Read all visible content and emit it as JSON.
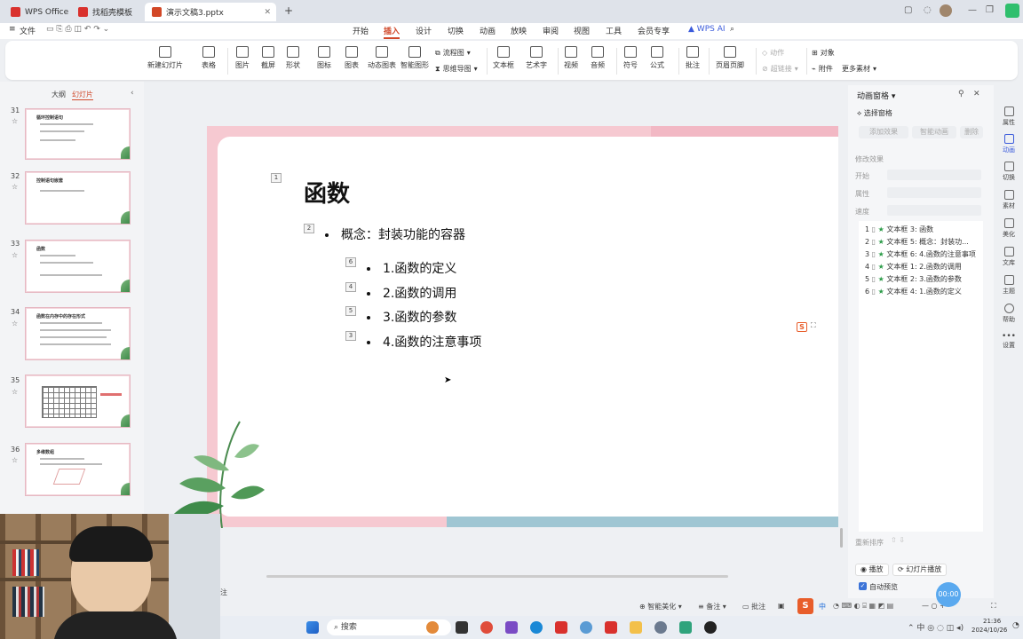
{
  "tabs": [
    {
      "label": "WPS Office",
      "icon": "wps-logo-icon",
      "color": "#d9312d"
    },
    {
      "label": "找稻壳模板",
      "icon": "docer-icon",
      "color": "#d9312d"
    },
    {
      "label": "演示文稿3.pptx",
      "icon": "ppt-icon",
      "color": "#d24726"
    }
  ],
  "new_tab": "+",
  "menu": {
    "file": "文件",
    "items": [
      "开始",
      "插入",
      "设计",
      "切换",
      "动画",
      "放映",
      "审阅",
      "视图",
      "工具",
      "会员专享"
    ],
    "active": "插入",
    "ai": "WPS AI"
  },
  "ribbon": {
    "buttons": [
      "新建幻灯片",
      "表格",
      "图片",
      "截屏",
      "形状",
      "图标",
      "图表",
      "动态图表",
      "智能图形"
    ],
    "flow": "流程图",
    "mind": "思维导图",
    "buttons2": [
      "文本框",
      "艺术字",
      "视频",
      "音频",
      "符号",
      "公式",
      "批注",
      "页眉页脚"
    ],
    "action": "动作",
    "hyperlink": "超链接",
    "object": "对象",
    "attach": "附件",
    "more": "更多素材"
  },
  "leftpane": {
    "tab_outline": "大纲",
    "tab_slides": "幻灯片",
    "slides": [
      {
        "num": "31",
        "title": "循环控制语句"
      },
      {
        "num": "32",
        "title": "控制语句嵌套"
      },
      {
        "num": "33",
        "title": "函数"
      },
      {
        "num": "34",
        "title": "函数在内存中的存在形式"
      },
      {
        "num": "35",
        "title": ""
      },
      {
        "num": "36",
        "title": "多维数组"
      }
    ]
  },
  "slide": {
    "title": "函数",
    "title_tag": "1",
    "concept_tag": "2",
    "concept": "概念：封装功能的容器",
    "items": [
      {
        "tag": "6",
        "text": "1.函数的定义"
      },
      {
        "tag": "4",
        "text": "2.函数的调用"
      },
      {
        "tag": "5",
        "text": "3.函数的参数"
      },
      {
        "tag": "3",
        "text": "4.函数的注意事项"
      }
    ]
  },
  "anim_pane": {
    "title": "动画窗格",
    "select_pane": "选择窗格",
    "add_effect": "添加效果",
    "smart_anim": "智能动画",
    "delete": "删除",
    "modify": "修改效果",
    "start": "开始",
    "property": "属性",
    "speed": "速度",
    "list": [
      {
        "num": "1",
        "text": "文本框 3: 函数"
      },
      {
        "num": "2",
        "text": "文本框 5: 概念：封装功..."
      },
      {
        "num": "3",
        "text": "文本框 6: 4.函数的注意事项"
      },
      {
        "num": "4",
        "text": "文本框 1: 2.函数的调用"
      },
      {
        "num": "5",
        "text": "文本框 2: 3.函数的参数"
      },
      {
        "num": "6",
        "text": "文本框 4: 1.函数的定义"
      }
    ],
    "reorder": "重新排序",
    "play": "播放",
    "slideshow": "幻灯片播放",
    "autopreview": "自动预览"
  },
  "sidebar": [
    "属性",
    "动画",
    "切换",
    "素材",
    "美化",
    "文库",
    "主题",
    "帮助",
    "设置"
  ],
  "status": {
    "notes_prefix": "注",
    "beautify": "智能美化",
    "notes": "备注",
    "comments": "批注",
    "timer": "00:00",
    "ime": "中"
  },
  "taskbar": {
    "search": "搜索",
    "time": "21:36",
    "date": "2024/10/26"
  }
}
